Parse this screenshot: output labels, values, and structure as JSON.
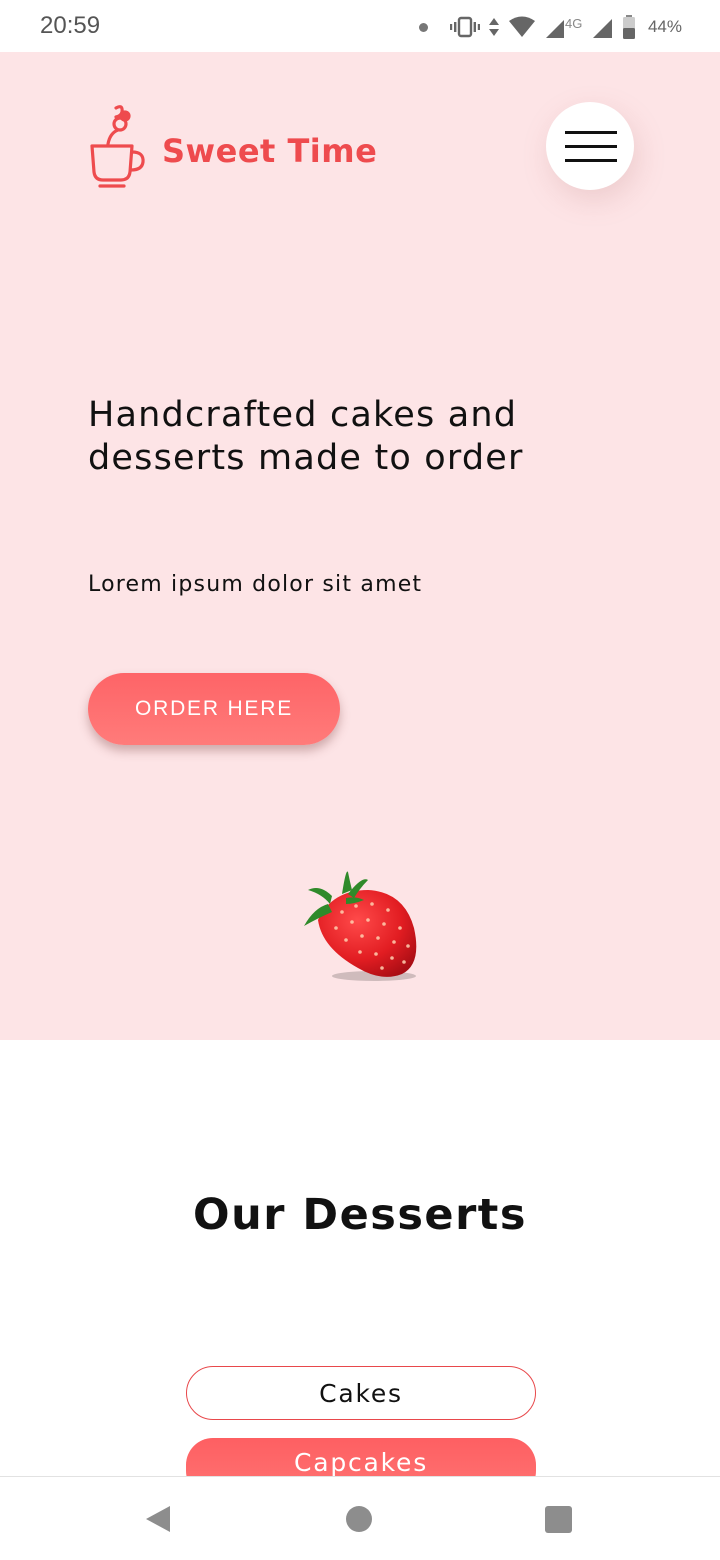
{
  "status_bar": {
    "time": "20:59",
    "battery": "44%",
    "network": "4G",
    "icons": [
      "notification-dot-icon",
      "vibrate-icon",
      "data-transfer-icon",
      "wifi-icon",
      "cell-signal-icon",
      "cell-signal-icon",
      "battery-icon"
    ]
  },
  "header": {
    "brand": "Sweet Time",
    "logo_icon": "cup-logo-icon",
    "menu_icon": "hamburger-menu-icon"
  },
  "hero": {
    "title": "Handcrafted cakes and desserts made to order",
    "subtitle": "Lorem ipsum dolor sit amet",
    "cta_label": "ORDER HERE",
    "image": "strawberry-image"
  },
  "desserts": {
    "title": "Our Desserts",
    "categories": [
      {
        "label": "Cakes",
        "selected": false
      },
      {
        "label": "Capcakes",
        "selected": true
      }
    ]
  },
  "nav_bar": {
    "icons": [
      "back-icon",
      "home-icon",
      "recents-icon"
    ]
  },
  "colors": {
    "hero_bg": "#fde4e6",
    "accent": "#ee4b4e",
    "button": "#fe6467",
    "nav_icon": "#8d8d8d"
  }
}
